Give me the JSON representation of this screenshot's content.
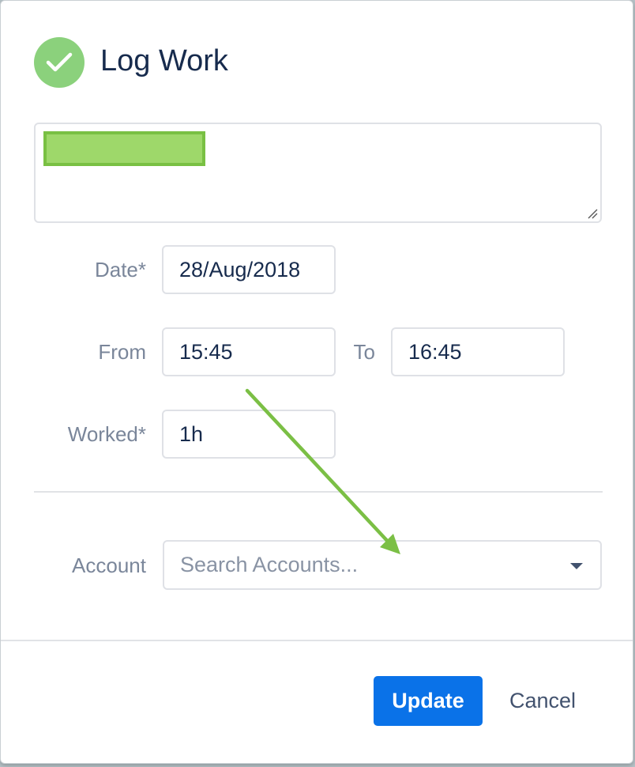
{
  "dialog": {
    "title": "Log Work",
    "header_icon": "check-circle-icon",
    "accent_color": "#8bd17c"
  },
  "form": {
    "date_label": "Date*",
    "date_value": "28/Aug/2018",
    "from_label": "From",
    "from_value": "15:45",
    "to_label": "To",
    "to_value": "16:45",
    "worked_label": "Worked*",
    "worked_value": "1h",
    "account_label": "Account",
    "account_placeholder": "Search Accounts..."
  },
  "footer": {
    "update_label": "Update",
    "cancel_label": "Cancel",
    "primary_color": "#0a72e8"
  },
  "annotation": {
    "arrow_color": "#7bbf45"
  }
}
